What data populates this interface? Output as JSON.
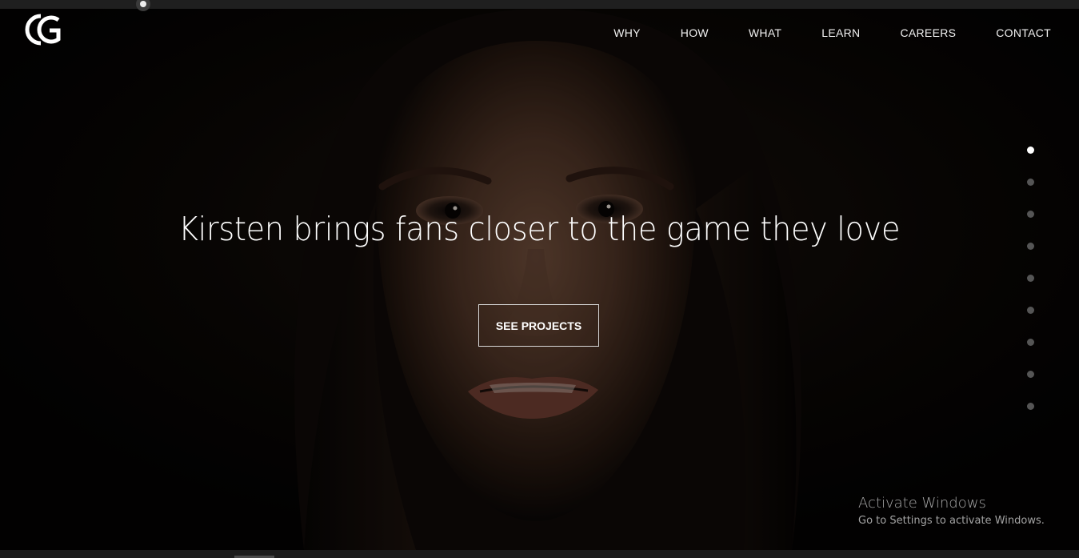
{
  "brand": {
    "logo_icon": "cg-monogram-logo-icon"
  },
  "nav": {
    "items": [
      {
        "label": "WHY"
      },
      {
        "label": "HOW"
      },
      {
        "label": "WHAT"
      },
      {
        "label": "LEARN"
      },
      {
        "label": "CAREERS"
      },
      {
        "label": "CONTACT"
      }
    ]
  },
  "hero": {
    "headline": "Kirsten brings fans closer to the game they love",
    "cta_label": "SEE PROJECTS",
    "background_icon": "portrait-photo",
    "slide_count": 9,
    "active_slide": 1
  },
  "watermark": {
    "title": "Activate Windows",
    "subtitle": "Go to Settings to activate Windows."
  },
  "colors": {
    "background": "#050403",
    "text": "#ffffff",
    "dot_inactive": "#555555",
    "dot_active": "#ffffff"
  }
}
